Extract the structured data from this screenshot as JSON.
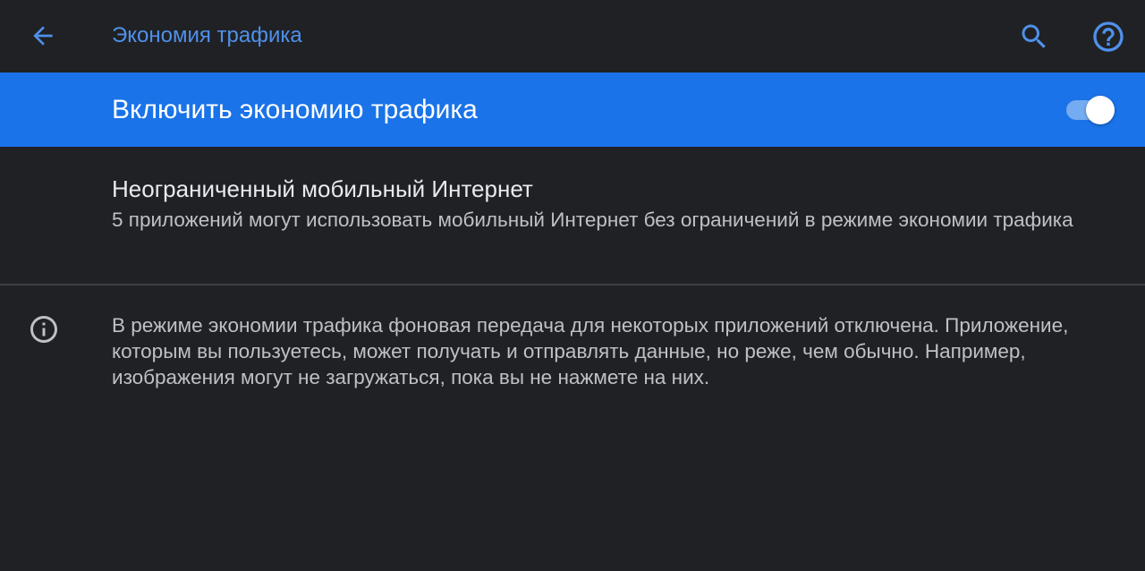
{
  "app_bar": {
    "title": "Экономия трафика",
    "back_icon": "arrow-back-icon",
    "search_icon": "search-icon",
    "help_icon": "help-icon",
    "accent_color": "#4f90ea"
  },
  "master_switch": {
    "label": "Включить экономию трафика",
    "enabled": true,
    "background_color": "#1a73e8"
  },
  "unlimited_data": {
    "title": "Неограниченный мобильный Интернет",
    "summary": "5 приложений могут использовать мобильный Интернет без ограничений в режиме экономии трафика"
  },
  "footer_info": {
    "icon": "info-icon",
    "text": "В режиме экономии трафика фоновая передача для некоторых приложений отключена. Приложение, которым вы пользуетесь, может получать и отправлять данные, но реже, чем обычно. Например, изображения могут не загружаться, пока вы не нажмете на них."
  }
}
